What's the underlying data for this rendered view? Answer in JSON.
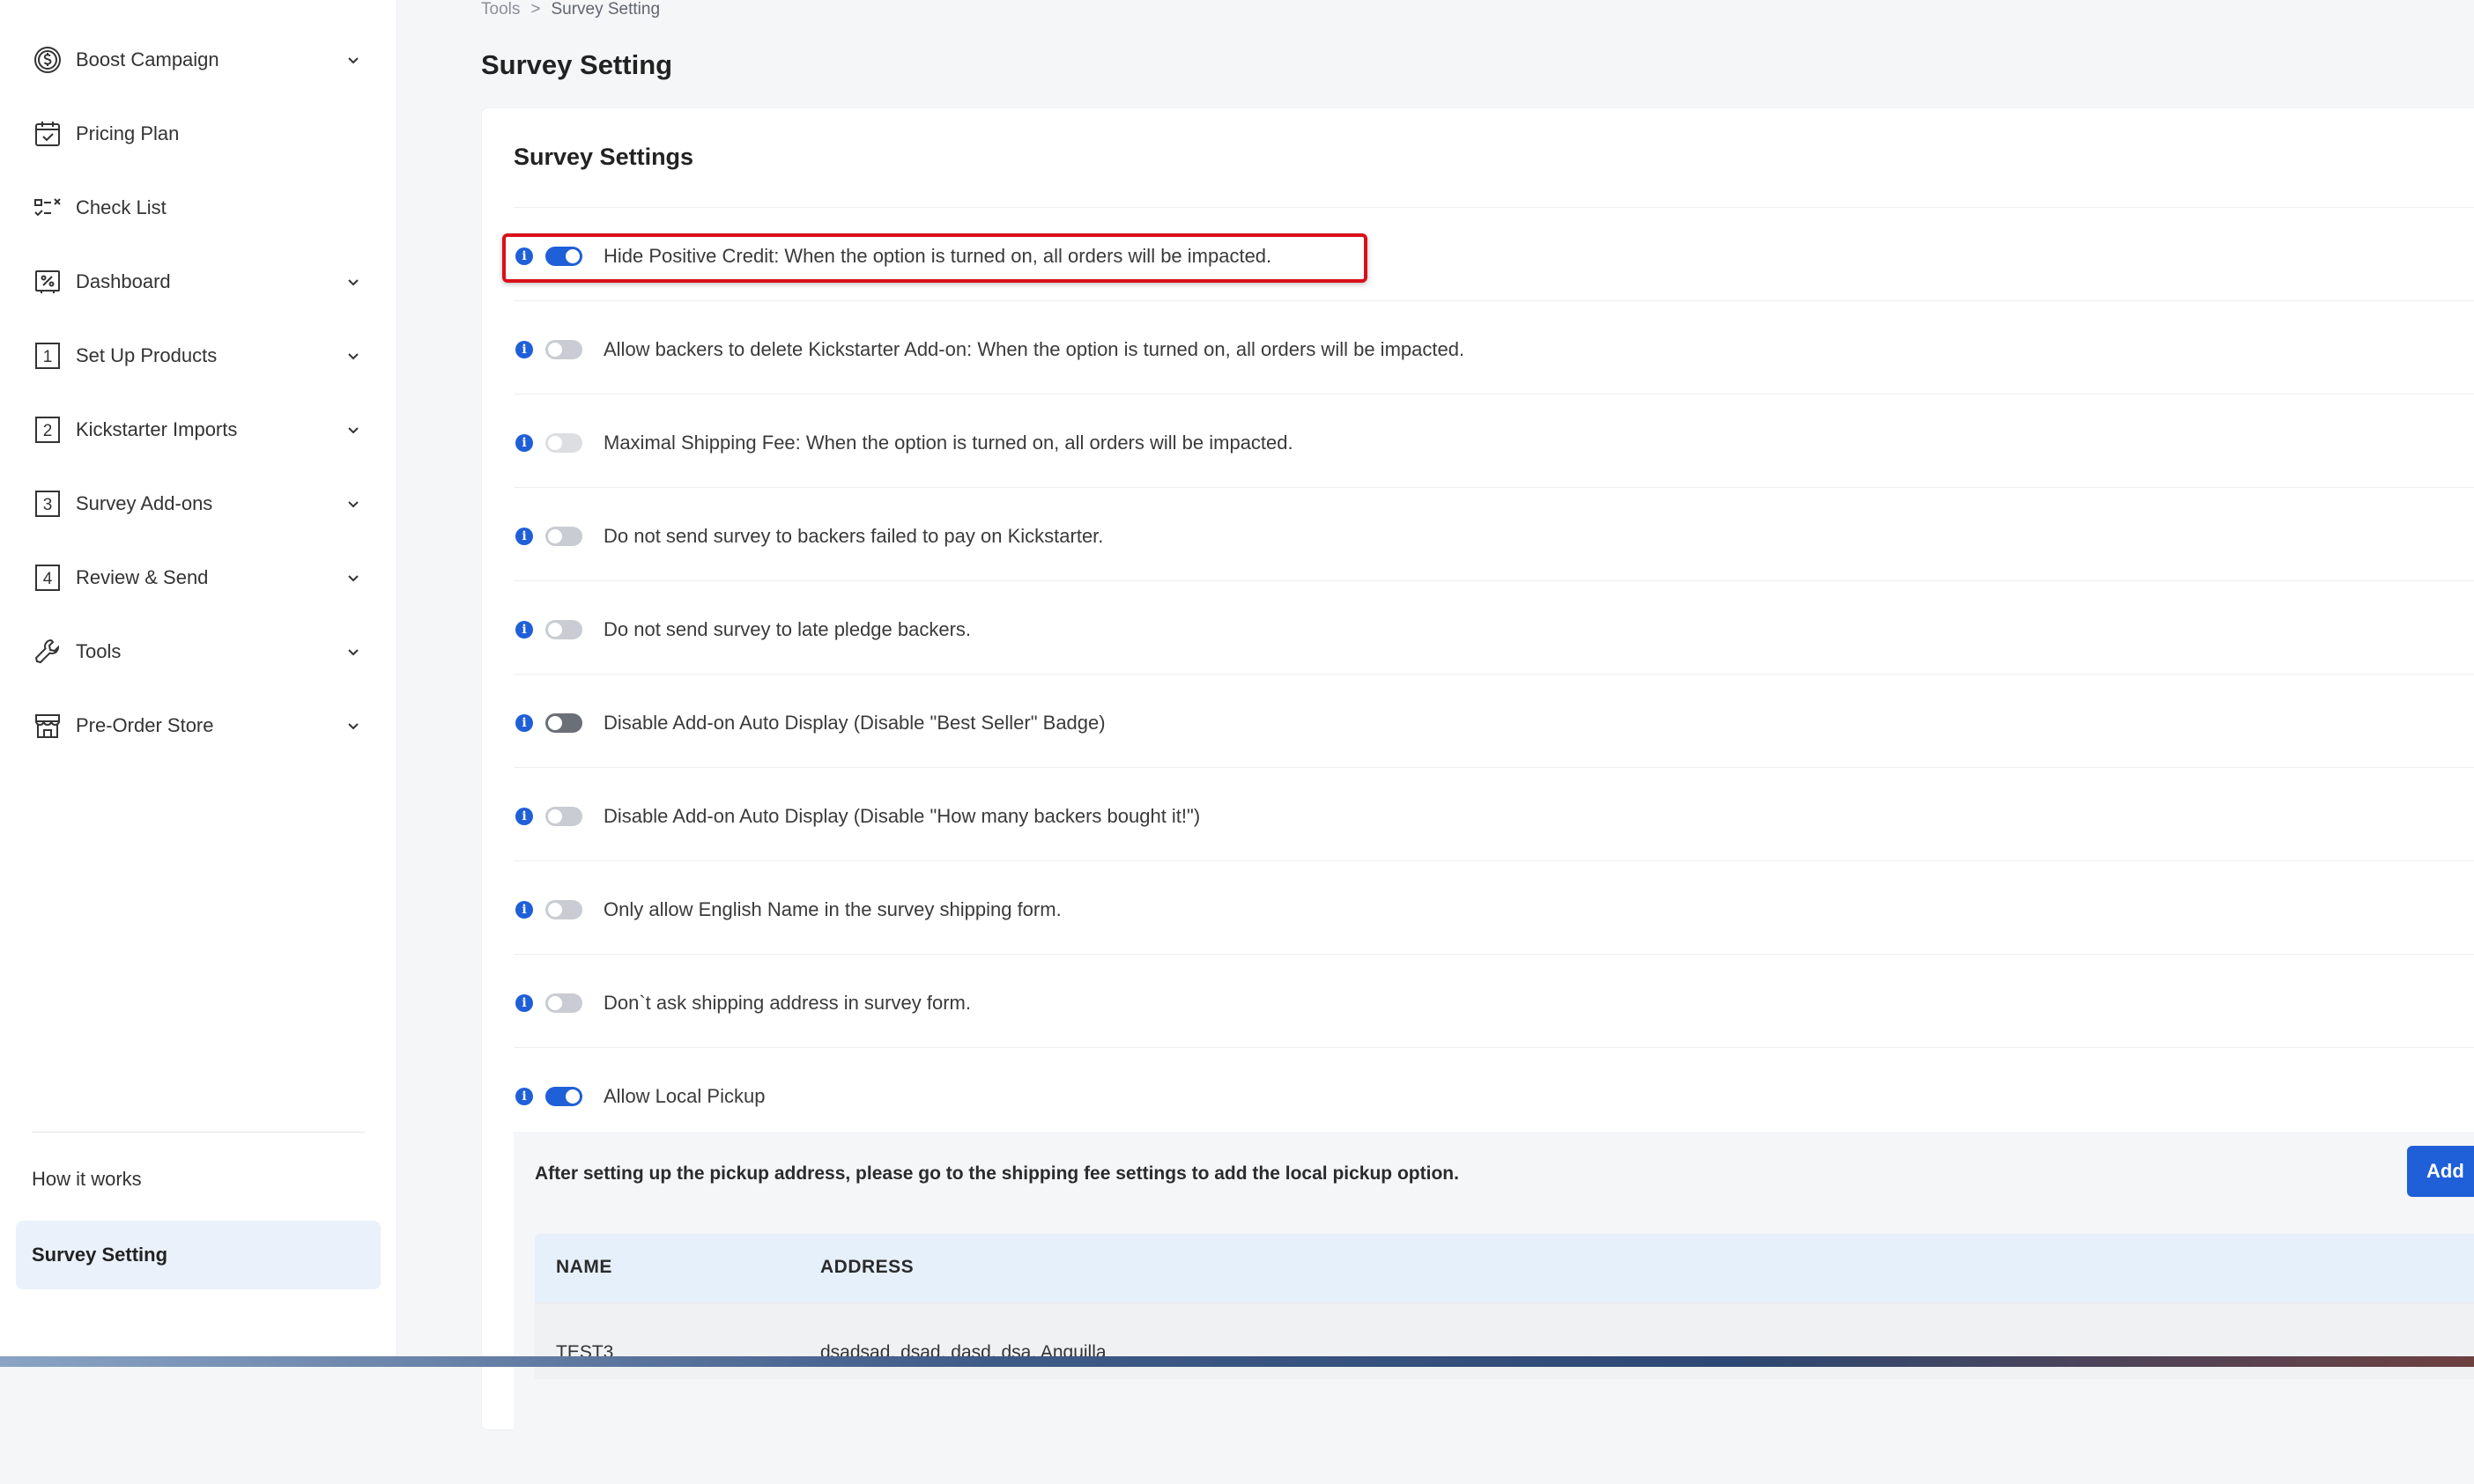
{
  "sidebar": {
    "items": [
      {
        "label": "Boost Campaign",
        "icon": "dollar-circle-icon",
        "expandable": true
      },
      {
        "label": "Pricing Plan",
        "icon": "calendar-check-icon",
        "expandable": false
      },
      {
        "label": "Check List",
        "icon": "checklist-icon",
        "expandable": false
      },
      {
        "label": "Dashboard",
        "icon": "dashboard-percent-icon",
        "expandable": true
      },
      {
        "label": "Set Up Products",
        "icon": "step-1-icon",
        "expandable": true
      },
      {
        "label": "Kickstarter Imports",
        "icon": "step-2-icon",
        "expandable": true
      },
      {
        "label": "Survey Add-ons",
        "icon": "step-3-icon",
        "expandable": true
      },
      {
        "label": "Review & Send",
        "icon": "step-4-icon",
        "expandable": true
      },
      {
        "label": "Tools",
        "icon": "wrench-icon",
        "expandable": true
      },
      {
        "label": "Pre-Order Store",
        "icon": "store-icon",
        "expandable": true
      }
    ],
    "step_numbers": [
      "1",
      "2",
      "3",
      "4"
    ],
    "how_it_works": "How it works",
    "active_item": "Survey Setting"
  },
  "breadcrumb": {
    "parent": "Tools",
    "separator": ">",
    "current": "Survey Setting"
  },
  "page_title": "Survey Setting",
  "card": {
    "title": "Survey Settings",
    "settings": [
      {
        "label": "Hide Positive Credit: When the option is turned on, all orders will be impacted.",
        "state": "on",
        "highlighted": true
      },
      {
        "label": "Allow backers to delete Kickstarter Add-on: When the option is turned on, all orders will be impacted.",
        "state": "off"
      },
      {
        "label": "Maximal Shipping Fee: When the option is turned on, all orders will be impacted.",
        "state": "disabled"
      },
      {
        "label": "Do not send survey to backers failed to pay on Kickstarter.",
        "state": "off"
      },
      {
        "label": "Do not send survey to late pledge backers.",
        "state": "off"
      },
      {
        "label": "Disable Add-on Auto Display (Disable \"Best Seller\" Badge)",
        "state": "off-dark"
      },
      {
        "label": "Disable Add-on Auto Display (Disable \"How many backers bought it!\")",
        "state": "off"
      },
      {
        "label": "Only allow English Name in the survey shipping form.",
        "state": "off"
      },
      {
        "label": "Don`t ask shipping address in survey form.",
        "state": "off"
      },
      {
        "label": "Allow Local Pickup",
        "state": "on"
      }
    ],
    "info_glyph": "i"
  },
  "pickup": {
    "note": "After setting up the pickup address, please go to the shipping fee settings to add the local pickup option.",
    "add_button": "Add",
    "columns": [
      "NAME",
      "ADDRESS"
    ],
    "rows": [
      {
        "name": "TEST3",
        "address": "dsadsad, dsad, dasd, dsa, Anguilla"
      }
    ]
  },
  "colors": {
    "accent": "#1f5fd8",
    "highlight_border": "#d9101a",
    "table_header": "#e6f0fb"
  }
}
